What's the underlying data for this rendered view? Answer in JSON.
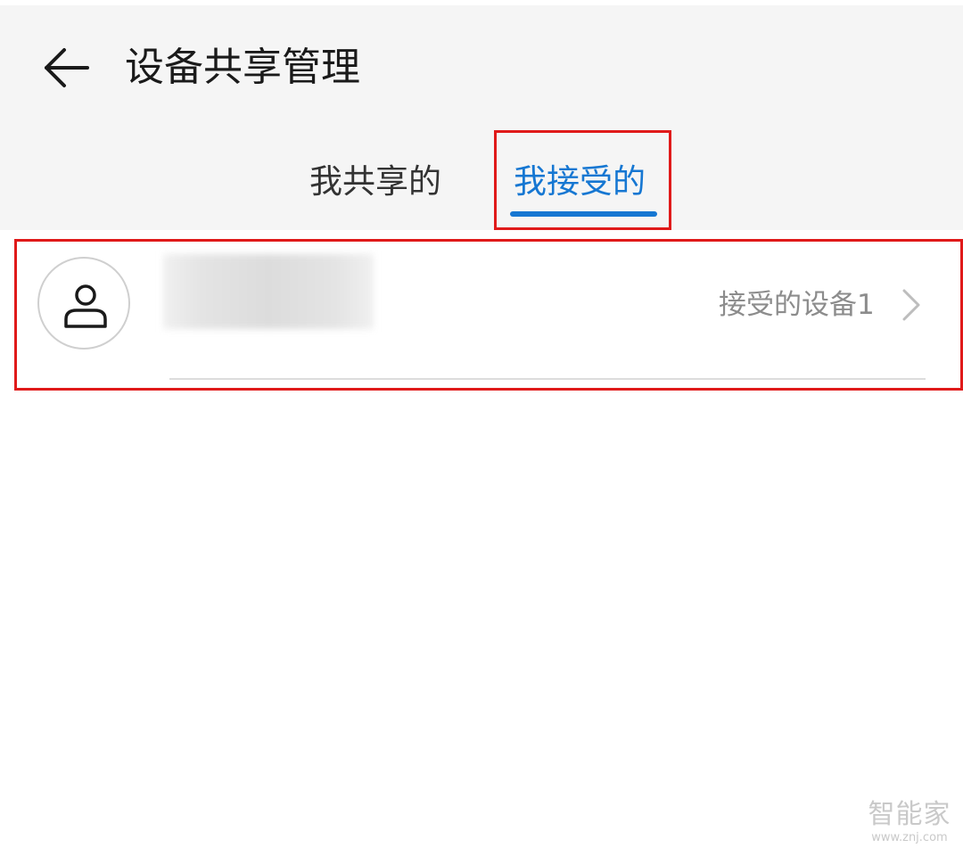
{
  "header": {
    "title": "设备共享管理",
    "back_icon": "arrow-left-icon"
  },
  "tabs": [
    {
      "label": "我共享的",
      "active": false
    },
    {
      "label": "我接受的",
      "active": true
    }
  ],
  "colors": {
    "accent": "#1677d2",
    "highlight": "#e01a1a",
    "header_bg": "#f5f5f5"
  },
  "list": [
    {
      "avatar_icon": "user-icon",
      "name": "",
      "device_count_label": "接受的设备1",
      "chevron_icon": "chevron-right-icon"
    }
  ],
  "watermark": {
    "logo": "智能家",
    "url": "www.znj.com"
  }
}
